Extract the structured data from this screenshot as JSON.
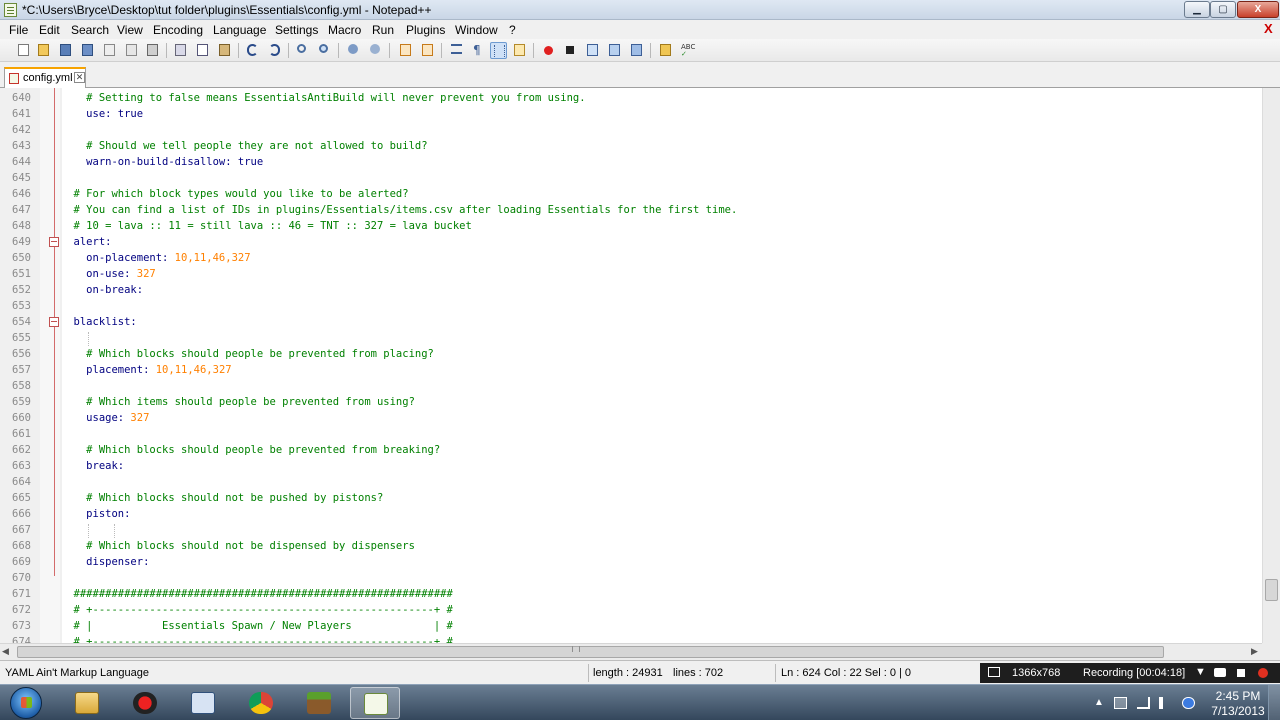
{
  "window": {
    "title": "*C:\\Users\\Bryce\\Desktop\\tut folder\\plugins\\Essentials\\config.yml - Notepad++",
    "controls": {
      "minimize": "▁",
      "maximize": "▢",
      "close": "X"
    }
  },
  "menu": {
    "items": [
      "File",
      "Edit",
      "Search",
      "View",
      "Encoding",
      "Language",
      "Settings",
      "Macro",
      "Run",
      "Plugins",
      "Window",
      "?"
    ],
    "close_doc": "X"
  },
  "toolbar": {
    "buttons": [
      "new-file",
      "open-file",
      "save",
      "save-all",
      "close",
      "close-all",
      "print",
      "cut",
      "copy",
      "paste",
      "undo",
      "redo",
      "find",
      "replace",
      "zoom-in",
      "zoom-out",
      "sync-vertical",
      "sync-horizontal",
      "word-wrap",
      "show-all-chars",
      "indent-guide",
      "user-language",
      "record-macro",
      "stop-recording",
      "playback",
      "run-multiple",
      "save-macro",
      "file-browser",
      "spellcheck"
    ]
  },
  "tabs": [
    {
      "label": "config.yml",
      "close": "✕"
    }
  ],
  "editor": {
    "lines": [
      {
        "n": "640",
        "text": "    # Setting to false means EssentialsAntiBuild will never prevent you from using."
      },
      {
        "n": "641",
        "text": "    use: true"
      },
      {
        "n": "642",
        "text": ""
      },
      {
        "n": "643",
        "text": "    # Should we tell people they are not allowed to build?"
      },
      {
        "n": "644",
        "text": "    warn-on-build-disallow: true"
      },
      {
        "n": "645",
        "text": ""
      },
      {
        "n": "646",
        "text": "  # For which block types would you like to be alerted?"
      },
      {
        "n": "647",
        "text": "  # You can find a list of IDs in plugins/Essentials/items.csv after loading Essentials for the first time."
      },
      {
        "n": "648",
        "text": "  # 10 = lava :: 11 = still lava :: 46 = TNT :: 327 = lava bucket"
      },
      {
        "n": "649",
        "text": "  alert:"
      },
      {
        "n": "650",
        "text": "    on-placement: 10,11,46,327"
      },
      {
        "n": "651",
        "text": "    on-use: 327"
      },
      {
        "n": "652",
        "text": "    on-break:"
      },
      {
        "n": "653",
        "text": ""
      },
      {
        "n": "654",
        "text": "  blacklist:"
      },
      {
        "n": "655",
        "text": ""
      },
      {
        "n": "656",
        "text": "    # Which blocks should people be prevented from placing?"
      },
      {
        "n": "657",
        "text": "    placement: 10,11,46,327"
      },
      {
        "n": "658",
        "text": ""
      },
      {
        "n": "659",
        "text": "    # Which items should people be prevented from using?"
      },
      {
        "n": "660",
        "text": "    usage: 327"
      },
      {
        "n": "661",
        "text": ""
      },
      {
        "n": "662",
        "text": "    # Which blocks should people be prevented from breaking?"
      },
      {
        "n": "663",
        "text": "    break:"
      },
      {
        "n": "664",
        "text": ""
      },
      {
        "n": "665",
        "text": "    # Which blocks should not be pushed by pistons?"
      },
      {
        "n": "666",
        "text": "    piston:"
      },
      {
        "n": "667",
        "text": ""
      },
      {
        "n": "668",
        "text": "    # Which blocks should not be dispensed by dispensers"
      },
      {
        "n": "669",
        "text": "    dispenser:"
      },
      {
        "n": "670",
        "text": ""
      },
      {
        "n": "671",
        "text": "############################################################"
      },
      {
        "n": "672",
        "text": "# +------------------------------------------------------+ #"
      },
      {
        "n": "673",
        "text": "# |           Essentials Spawn / New Players             | #"
      },
      {
        "n": "674",
        "text": "# +------------------------------------------------------+ #"
      }
    ],
    "fold_markers": [
      "649",
      "654"
    ]
  },
  "statusbar": {
    "language": "YAML Ain't Markup Language",
    "length": "length : 24931",
    "lines": "lines : 702",
    "position": "Ln : 624    Col : 22    Sel : 0 | 0"
  },
  "recorder": {
    "resolution": "1366x768",
    "status": "Recording [00:04:18]",
    "dropdown": "▼"
  },
  "taskbar": {
    "apps": [
      "windows-explorer",
      "recording-app",
      "virtualbox",
      "chrome",
      "minecraft",
      "notepad-plus-plus"
    ],
    "tray_arrow": "▲",
    "time": "2:45 PM",
    "date": "7/13/2013"
  },
  "colors": {
    "comment": "#008000",
    "key": "#000080",
    "number": "#ff8000",
    "tab_accent": "#f7a300"
  }
}
